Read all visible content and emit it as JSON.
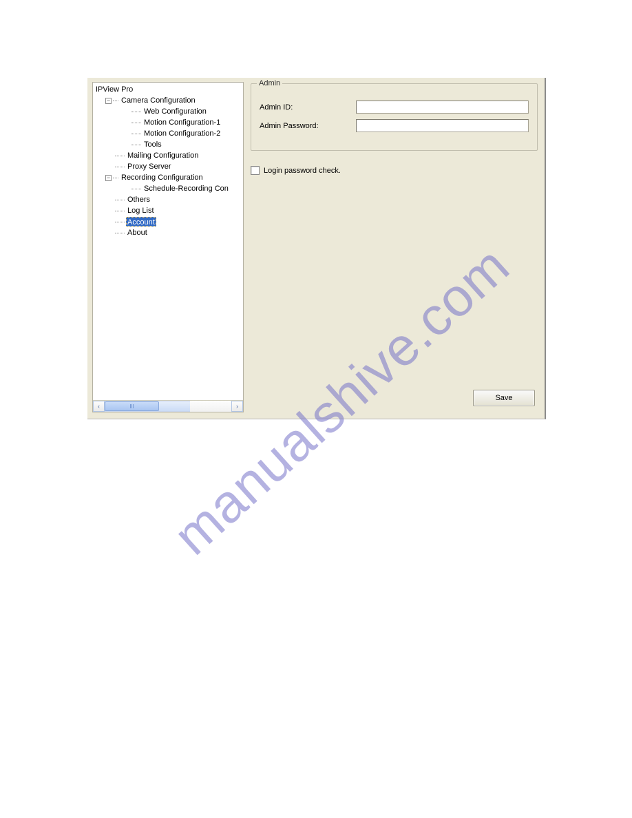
{
  "tree": {
    "root": "IPView Pro",
    "camera_config": "Camera Configuration",
    "web_config": "Web Configuration",
    "motion1": "Motion Configuration-1",
    "motion2": "Motion Configuration-2",
    "tools": "Tools",
    "mailing": "Mailing Configuration",
    "proxy": "Proxy Server",
    "recording": "Recording Configuration",
    "schedule": "Schedule-Recording Con",
    "others": "Others",
    "loglist": "Log List",
    "account": "Account",
    "about": "About"
  },
  "admin": {
    "group_title": "Admin",
    "id_label": "Admin ID:",
    "id_value": "",
    "pw_label": "Admin Password:",
    "pw_value": ""
  },
  "login_check_label": "Login password check.",
  "save_label": "Save",
  "expander_minus": "−",
  "scroll_left": "‹",
  "scroll_right": "›",
  "watermark": "manualshive.com"
}
